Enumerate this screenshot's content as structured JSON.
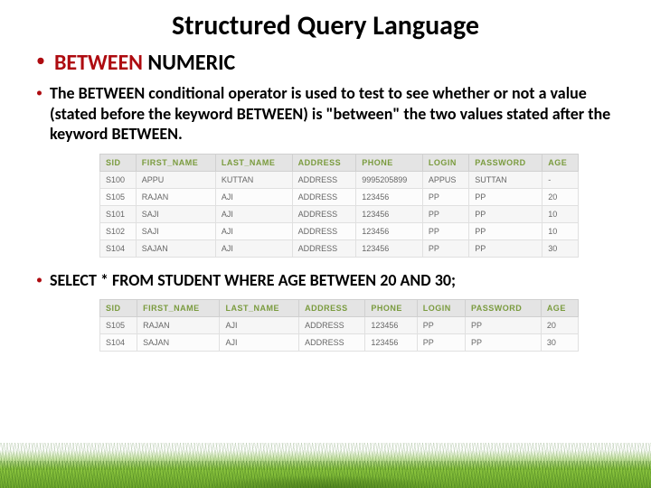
{
  "title": "Structured Query Language",
  "heading_between": "BETWEEN",
  "heading_numeric": " NUMERIC",
  "description": "The BETWEEN conditional operator is used to test to see whether or not a value (stated before the keyword BETWEEN) is \"between\" the two values stated after the keyword BETWEEN.",
  "query": "SELECT * FROM STUDENT WHERE AGE BETWEEN 20 AND 30;",
  "table1": {
    "headers": [
      "SID",
      "FIRST_NAME",
      "LAST_NAME",
      "ADDRESS",
      "PHONE",
      "LOGIN",
      "PASSWORD",
      "AGE"
    ],
    "rows": [
      [
        "S100",
        "APPU",
        "KUTTAN",
        "ADDRESS",
        "9995205899",
        "APPUS",
        "SUTTAN",
        "-"
      ],
      [
        "S105",
        "RAJAN",
        "AJI",
        "ADDRESS",
        "123456",
        "PP",
        "PP",
        "20"
      ],
      [
        "S101",
        "SAJI",
        "AJI",
        "ADDRESS",
        "123456",
        "PP",
        "PP",
        "10"
      ],
      [
        "S102",
        "SAJI",
        "AJI",
        "ADDRESS",
        "123456",
        "PP",
        "PP",
        "10"
      ],
      [
        "S104",
        "SAJAN",
        "AJI",
        "ADDRESS",
        "123456",
        "PP",
        "PP",
        "30"
      ]
    ]
  },
  "table2": {
    "headers": [
      "SID",
      "FIRST_NAME",
      "LAST_NAME",
      "ADDRESS",
      "PHONE",
      "LOGIN",
      "PASSWORD",
      "AGE"
    ],
    "rows": [
      [
        "S105",
        "RAJAN",
        "AJI",
        "ADDRESS",
        "123456",
        "PP",
        "PP",
        "20"
      ],
      [
        "S104",
        "SAJAN",
        "AJI",
        "ADDRESS",
        "123456",
        "PP",
        "PP",
        "30"
      ]
    ]
  }
}
